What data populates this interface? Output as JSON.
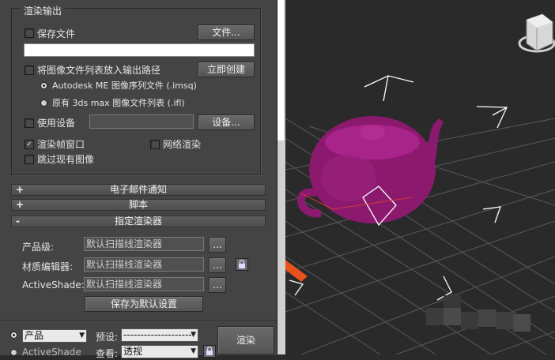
{
  "output_group": {
    "title": "渲染输出",
    "save_file_label": "保存文件",
    "file_button": "文件...",
    "path_value": "",
    "image_list_label": "将图像文件列表放入输出路径",
    "create_now_button": "立即创建",
    "radio_autodesk": "Autodesk ME 图像序列文件 (.imsq)",
    "radio_3dsmax": "原有 3ds max 图像文件列表 (.ifl)",
    "use_device_label": "使用设备",
    "device_field": "",
    "device_button": "设备...",
    "frame_window_label": "渲染帧窗口",
    "net_render_label": "网络渲染",
    "skip_existing_label": "跳过现有图像"
  },
  "rollouts": {
    "email": "电子邮件通知",
    "script": "脚本",
    "assign_renderer": "指定渲染器",
    "plus": "+",
    "minus": "-"
  },
  "renderer": {
    "production_label": "产品级:",
    "production_value": "默认扫描线渲染器",
    "material_label": "材质编辑器:",
    "material_value": "默认扫描线渲染器",
    "activeshade_label": "ActiveShade:",
    "activeshade_value": "默认扫描线渲染器",
    "dots": "...",
    "save_default_button": "保存为默认设置"
  },
  "bottom": {
    "mode_product": "产品",
    "mode_activeshade": "ActiveShade",
    "preset_label": "预设:",
    "preset_value": "--------------------",
    "view_label": "查看:",
    "view_value": "透视",
    "render_button": "渲染"
  },
  "colors": {
    "teapot": "#8b1a6e",
    "arrow": "#e8521c",
    "panel_bg": "#444444",
    "viewport_bg": "#2a2a2a"
  }
}
